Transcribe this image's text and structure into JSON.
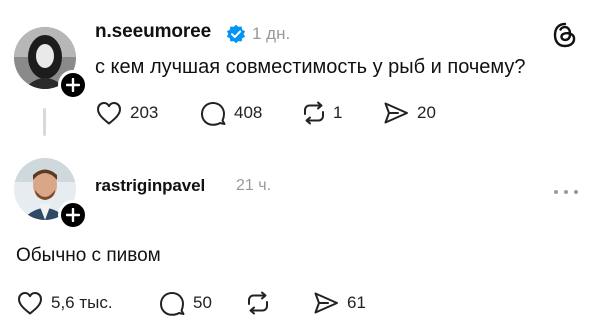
{
  "post": {
    "username": "n.seeumoree",
    "time": "1 дн.",
    "text": "с кем лучшая совместимость у рыб и почему?",
    "likes": "203",
    "replies": "408",
    "reposts": "1",
    "shares": "20"
  },
  "reply": {
    "username": "rastriginpavel",
    "time": "21 ч.",
    "text": "Обычно с пивом",
    "likes": "5,6 тыс.",
    "replies": "50",
    "shares": "61"
  },
  "icons": {
    "verified": "verified-badge-icon",
    "app": "threads-logo-icon",
    "like": "heart-icon",
    "reply": "comment-icon",
    "repost": "repost-icon",
    "share": "send-icon",
    "more": "more-dots-icon",
    "follow": "plus-icon"
  },
  "colors": {
    "verified": "#0095f6",
    "muted": "#9a9a9a",
    "text": "#111111"
  }
}
